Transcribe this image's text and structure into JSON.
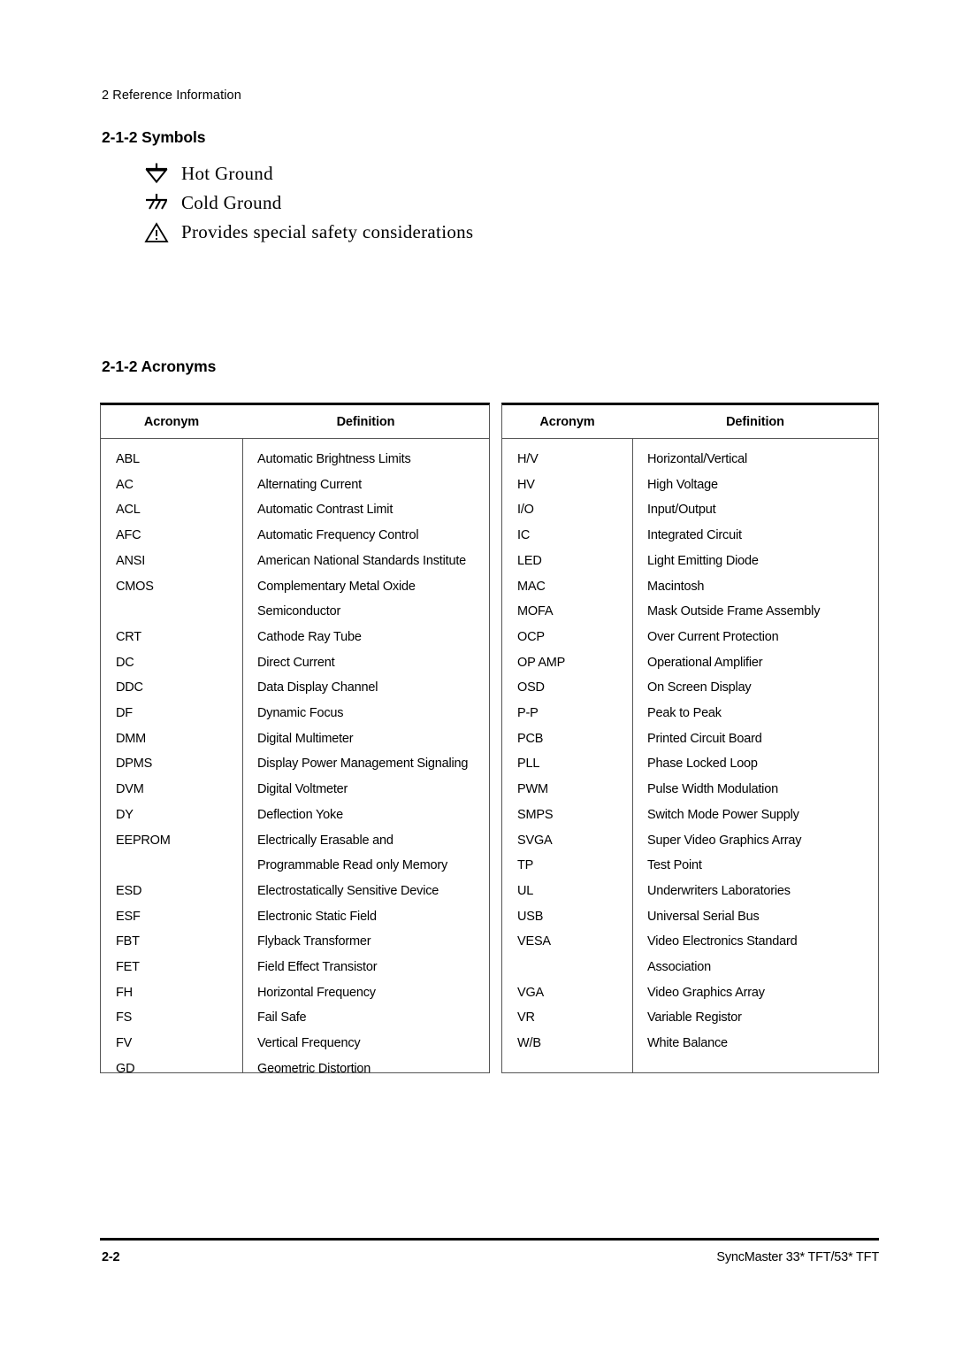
{
  "header": {
    "running_head": "2 Reference Information"
  },
  "symbols_section": {
    "heading": "2-1-2 Symbols",
    "items": [
      {
        "icon": "hot-ground-icon",
        "label": "Hot Ground"
      },
      {
        "icon": "cold-ground-icon",
        "label": "Cold Ground"
      },
      {
        "icon": "warning-triangle-icon",
        "label": "Provides special safety considerations"
      }
    ]
  },
  "acronyms_section": {
    "heading": "2-1-2 Acronyms",
    "columns": [
      "Acronym",
      "Definition"
    ],
    "left_table": [
      {
        "acronym": "ABL",
        "definition": [
          "Automatic Brightness Limits"
        ]
      },
      {
        "acronym": "AC",
        "definition": [
          "Alternating Current"
        ]
      },
      {
        "acronym": "ACL",
        "definition": [
          "Automatic Contrast Limit"
        ]
      },
      {
        "acronym": "AFC",
        "definition": [
          "Automatic Frequency Control"
        ]
      },
      {
        "acronym": "ANSI",
        "definition": [
          "American National Standards Institute"
        ]
      },
      {
        "acronym": "CMOS",
        "definition": [
          "Complementary Metal Oxide",
          "Semiconductor"
        ]
      },
      {
        "acronym": "CRT",
        "definition": [
          "Cathode Ray Tube"
        ]
      },
      {
        "acronym": "DC",
        "definition": [
          "Direct Current"
        ]
      },
      {
        "acronym": "DDC",
        "definition": [
          "Data Display Channel"
        ]
      },
      {
        "acronym": "DF",
        "definition": [
          "Dynamic Focus"
        ]
      },
      {
        "acronym": "DMM",
        "definition": [
          "Digital Multimeter"
        ]
      },
      {
        "acronym": "DPMS",
        "definition": [
          "Display Power Management Signaling"
        ]
      },
      {
        "acronym": "DVM",
        "definition": [
          "Digital Voltmeter"
        ]
      },
      {
        "acronym": "DY",
        "definition": [
          "Deflection Yoke"
        ]
      },
      {
        "acronym": "EEPROM",
        "definition": [
          "Electrically Erasable and",
          "Programmable Read only Memory"
        ]
      },
      {
        "acronym": "ESD",
        "definition": [
          "Electrostatically Sensitive Device"
        ]
      },
      {
        "acronym": "ESF",
        "definition": [
          "Electronic Static Field"
        ]
      },
      {
        "acronym": "FBT",
        "definition": [
          "Flyback Transformer"
        ]
      },
      {
        "acronym": "FET",
        "definition": [
          "Field Effect Transistor"
        ]
      },
      {
        "acronym": "FH",
        "definition": [
          "Horizontal Frequency"
        ]
      },
      {
        "acronym": "FS",
        "definition": [
          "Fail Safe"
        ]
      },
      {
        "acronym": "FV",
        "definition": [
          "Vertical Frequency"
        ]
      },
      {
        "acronym": "GD",
        "definition": [
          "Geometric Distortion"
        ]
      }
    ],
    "right_table": [
      {
        "acronym": "H/V",
        "definition": [
          "Horizontal/Vertical"
        ]
      },
      {
        "acronym": "HV",
        "definition": [
          "High Voltage"
        ]
      },
      {
        "acronym": "I/O",
        "definition": [
          "Input/Output"
        ]
      },
      {
        "acronym": "IC",
        "definition": [
          "Integrated Circuit"
        ]
      },
      {
        "acronym": "LED",
        "definition": [
          "Light Emitting Diode"
        ]
      },
      {
        "acronym": "MAC",
        "definition": [
          "Macintosh"
        ]
      },
      {
        "acronym": "MOFA",
        "definition": [
          "Mask Outside Frame Assembly"
        ]
      },
      {
        "acronym": "OCP",
        "definition": [
          "Over Current Protection"
        ]
      },
      {
        "acronym": "OP AMP",
        "definition": [
          "Operational Amplifier"
        ]
      },
      {
        "acronym": "OSD",
        "definition": [
          "On Screen Display"
        ]
      },
      {
        "acronym": "P-P",
        "definition": [
          "Peak to Peak"
        ]
      },
      {
        "acronym": "PCB",
        "definition": [
          "Printed Circuit Board"
        ]
      },
      {
        "acronym": "PLL",
        "definition": [
          "Phase Locked Loop"
        ]
      },
      {
        "acronym": "PWM",
        "definition": [
          "Pulse Width Modulation"
        ]
      },
      {
        "acronym": "SMPS",
        "definition": [
          "Switch Mode Power Supply"
        ]
      },
      {
        "acronym": "SVGA",
        "definition": [
          "Super Video Graphics Array"
        ]
      },
      {
        "acronym": "TP",
        "definition": [
          "Test Point"
        ]
      },
      {
        "acronym": "UL",
        "definition": [
          "Underwriters Laboratories"
        ]
      },
      {
        "acronym": "USB",
        "definition": [
          "Universal Serial Bus"
        ]
      },
      {
        "acronym": "VESA",
        "definition": [
          "Video Electronics Standard",
          "Association"
        ]
      },
      {
        "acronym": "VGA",
        "definition": [
          "Video Graphics Array"
        ]
      },
      {
        "acronym": "VR",
        "definition": [
          "Variable Registor"
        ]
      },
      {
        "acronym": "W/B",
        "definition": [
          "White Balance"
        ]
      }
    ]
  },
  "footer": {
    "page_number": "2-2",
    "model": "SyncMaster 33* TFT/53* TFT"
  }
}
